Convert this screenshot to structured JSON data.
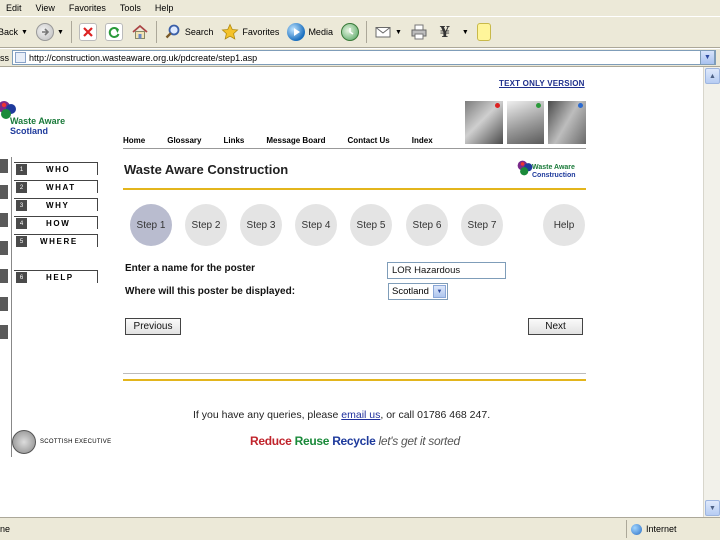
{
  "browser": {
    "menu": [
      "Edit",
      "View",
      "Favorites",
      "Tools",
      "Help"
    ],
    "toolbar": {
      "back_label": "Back",
      "search_label": "Search",
      "favorites_label": "Favorites",
      "media_label": "Media"
    },
    "address": {
      "label": "ess",
      "url": "http://construction.wasteaware.org.uk/pdcreate/step1.asp"
    },
    "status": {
      "left_text": "ne",
      "zone_text": "Internet"
    }
  },
  "page": {
    "text_only_link": "TEXT ONLY VERSION",
    "logo_main": {
      "line1": "Waste Aware",
      "line2": "Scotland"
    },
    "top_nav": [
      "Home",
      "Glossary",
      "Links",
      "Message Board",
      "Contact Us",
      "Index"
    ],
    "side_nav": [
      "WHO",
      "WHAT",
      "WHY",
      "HOW",
      "WHERE",
      "HELP"
    ],
    "side_nav_tags": [
      "1",
      "2",
      "3",
      "4",
      "5",
      "6"
    ],
    "exec_logo_text": "SCOTTISH EXECUTIVE",
    "heading": "Waste Aware Construction",
    "logo_small": {
      "line1": "Waste Aware",
      "line2": "Construction"
    },
    "steps": [
      "Step 1",
      "Step 2",
      "Step 3",
      "Step 4",
      "Step 5",
      "Step 6",
      "Step 7",
      "Help"
    ],
    "active_step": "Step 1",
    "form": {
      "name_label": "Enter a name for the poster",
      "name_value": "LOR Hazardous",
      "location_label": "Where will this poster be displayed:",
      "location_value": "Scotland"
    },
    "buttons": {
      "previous": "Previous",
      "next": "Next"
    },
    "query": {
      "before": "If you have any queries, please ",
      "email": "email us",
      "after": ", or call 01786 468 247."
    },
    "tagline": {
      "reduce": "Reduce",
      "reuse": "Reuse",
      "recycle": "Recycle",
      "rest": "let's get it sorted"
    }
  },
  "colors": {
    "rule_yellow": "#e3b51c",
    "link_blue": "#1e2f8c",
    "reduce_red": "#c0242c",
    "reuse_green": "#1a8a3a",
    "recycle_blue": "#1e3a9c"
  }
}
